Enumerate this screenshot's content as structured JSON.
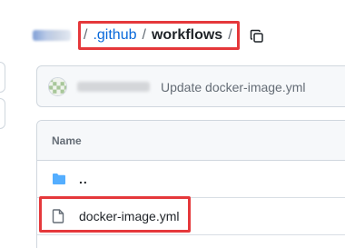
{
  "breadcrumb": {
    "separator": "/",
    "folder_link": ".github",
    "current_folder": "workflows",
    "trailing_separator": "/"
  },
  "commit": {
    "message": "Update docker-image.yml"
  },
  "file_table": {
    "header": "Name",
    "rows": [
      {
        "name": "..",
        "icon": "folder-icon"
      },
      {
        "name": "docker-image.yml",
        "icon": "file-icon"
      }
    ]
  },
  "colors": {
    "link": "#0969da",
    "highlight_border": "#e5383b",
    "folder_icon": "#54aeff"
  }
}
